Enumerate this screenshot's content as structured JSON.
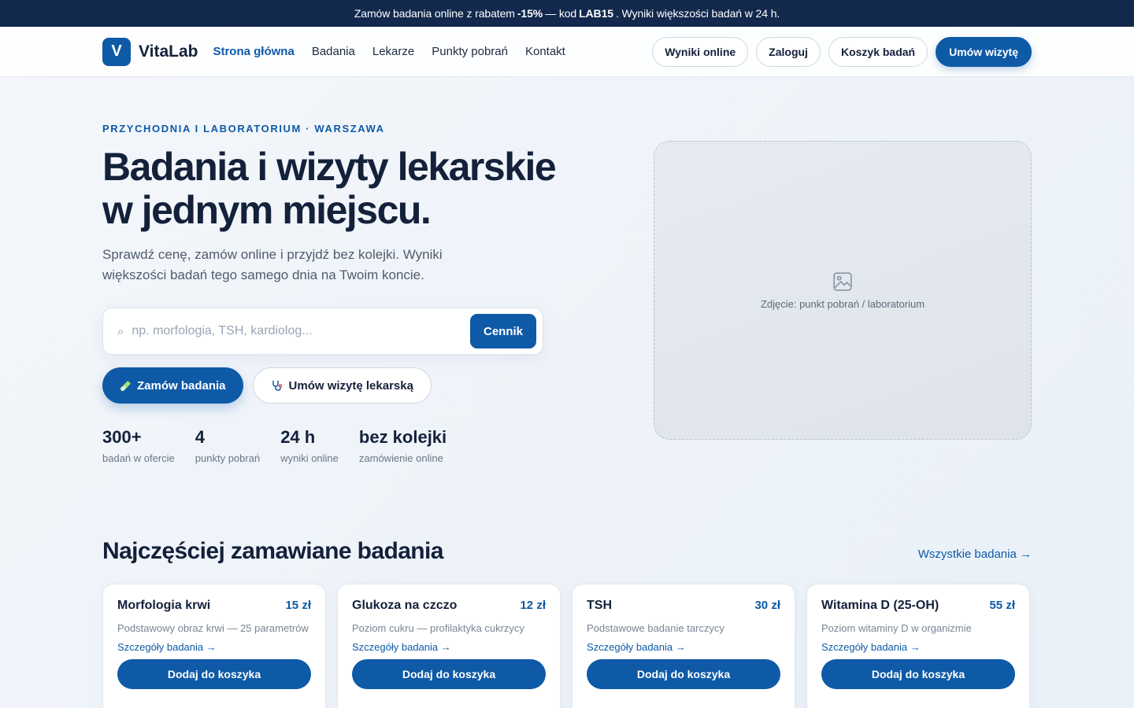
{
  "announcement": {
    "text_1": "Zamów badania online z rabatem",
    "discount": "-15%",
    "text_2": "— kod",
    "code": "LAB15",
    "text_3": ". Wyniki większości badań w 24 h."
  },
  "header": {
    "logo_letter": "V",
    "brand": "VitaLab",
    "nav": [
      {
        "label": "Strona główna"
      },
      {
        "label": "Badania"
      },
      {
        "label": "Lekarze"
      },
      {
        "label": "Punkty pobrań"
      },
      {
        "label": "Kontakt"
      }
    ],
    "actions": {
      "results": "Wyniki online",
      "login": "Zaloguj",
      "cart": "Koszyk badań",
      "book": "Umów wizytę"
    }
  },
  "hero": {
    "eyebrow": "PRZYCHODNIA I LABORATORIUM · WARSZAWA",
    "title_line1": "Badania i wizyty lekarskie",
    "title_line2": "w jednym miejscu.",
    "lead": "Sprawdź cenę, zamów online i przyjdź bez kolejki. Wyniki większości badań tego samego dnia na Twoim koncie.",
    "search_placeholder": "np. morfologia, TSH, kardiolog...",
    "search_value": "",
    "search_button": "Cennik",
    "cta_primary": "Zamów badania",
    "cta_secondary": "Umów wizytę lekarską",
    "stats": [
      {
        "value": "300+",
        "label": "badań w ofercie"
      },
      {
        "value": "4",
        "label": "punkty pobrań"
      },
      {
        "value": "24 h",
        "label": "wyniki online"
      },
      {
        "value": "bez kolejki",
        "label": "zamówienie online"
      }
    ],
    "photo_label": "Zdjęcie: punkt pobrań / laboratorium"
  },
  "popular": {
    "title": "Najczęściej zamawiane badania",
    "all_link": "Wszystkie badania →",
    "cards": [
      {
        "name": "Morfologia krwi",
        "price": "15 zł",
        "desc": "Podstawowy obraz krwi — 25 parametrów",
        "link": "Szczegóły badania →",
        "button": "Dodaj do koszyka"
      },
      {
        "name": "Glukoza na czczo",
        "price": "12 zł",
        "desc": "Poziom cukru — profilaktyka cukrzycy",
        "link": "Szczegóły badania →",
        "button": "Dodaj do koszyka"
      },
      {
        "name": "TSH",
        "price": "30 zł",
        "desc": "Podstawowe badanie tarczycy",
        "link": "Szczegóły badania →",
        "button": "Dodaj do koszyka"
      },
      {
        "name": "Witamina D (25-OH)",
        "price": "55 zł",
        "desc": "Poziom witaminy D w organizmie",
        "link": "Szczegóły badania →",
        "button": "Dodaj do koszyka"
      }
    ]
  },
  "colors": {
    "primary": "#0e5aa7",
    "dark": "#12294d",
    "text": "#14213a"
  },
  "icons": {
    "search": "search-icon",
    "test_tube": "test-tube-icon",
    "stethoscope": "stethoscope-icon",
    "image": "image-placeholder-icon"
  }
}
